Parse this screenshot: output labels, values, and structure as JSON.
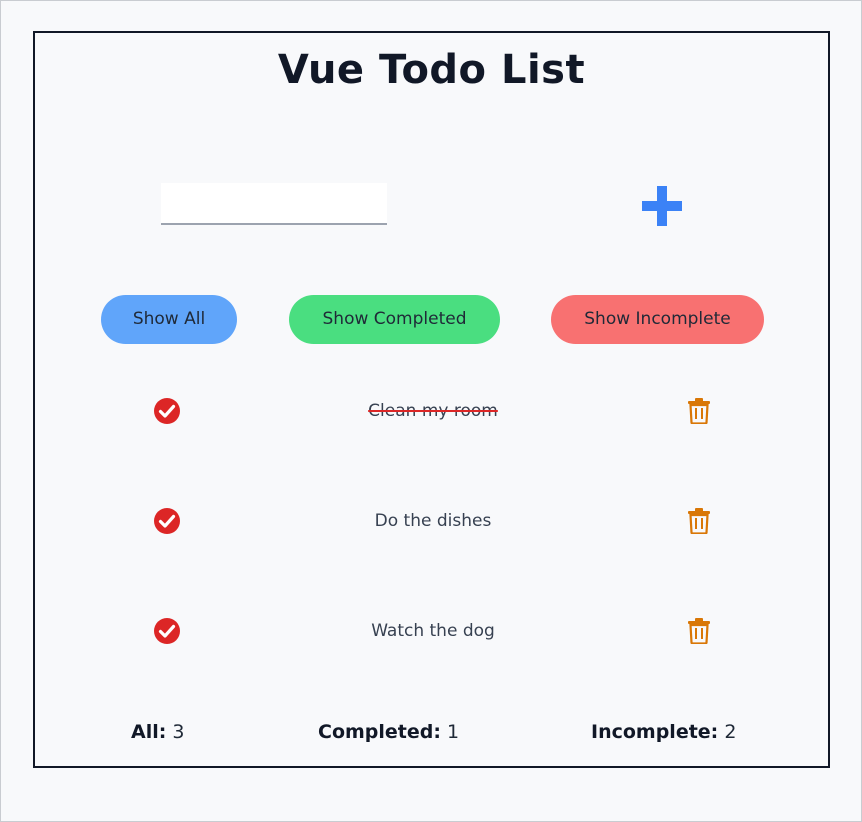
{
  "app": {
    "title": "Vue Todo List"
  },
  "input": {
    "value": "",
    "placeholder": ""
  },
  "filters": [
    {
      "label": "Show All",
      "color": "#60a5fa"
    },
    {
      "label": "Show Completed",
      "color": "#4ade80"
    },
    {
      "label": "Show Incomplete",
      "color": "#f87171"
    }
  ],
  "todos": [
    {
      "text": "Clean my room",
      "completed": true
    },
    {
      "text": "Do the dishes",
      "completed": false
    },
    {
      "text": "Watch the dog",
      "completed": false
    }
  ],
  "stats": {
    "all_label": "All:",
    "all_count": "3",
    "completed_label": "Completed:",
    "completed_count": "1",
    "incomplete_label": "Incomplete:",
    "incomplete_count": "2"
  },
  "colors": {
    "add_icon": "#3b82f6",
    "check_icon": "#dc2626",
    "trash_icon": "#d97706",
    "border": "#111827"
  },
  "icons": {
    "add": "plus-icon",
    "check": "check-circle-icon",
    "delete": "trash-icon"
  }
}
